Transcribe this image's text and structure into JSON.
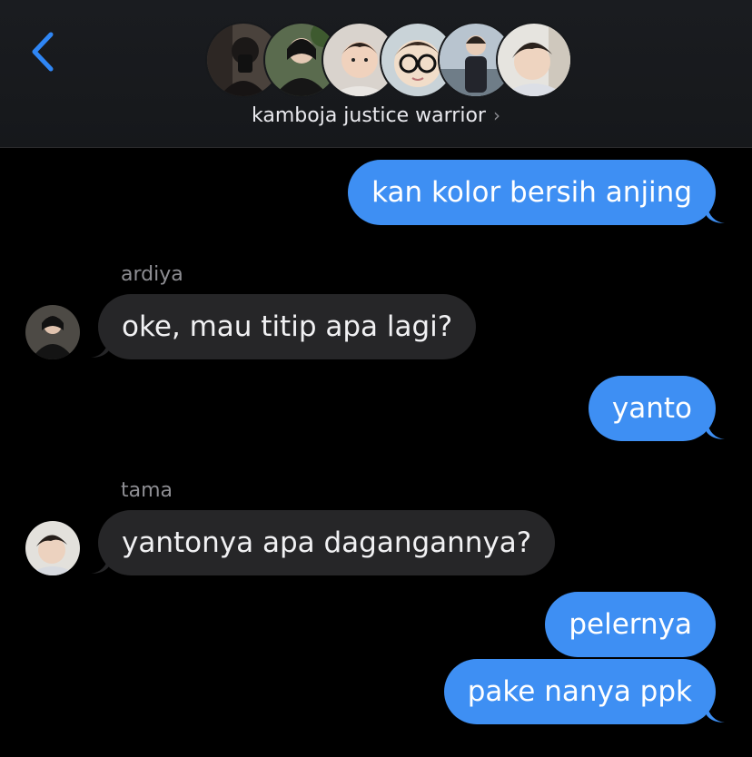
{
  "header": {
    "group_name": "kamboja justice warrior",
    "chevron": "›",
    "back_icon": "chevron-left-icon",
    "accent": "#2f86f5"
  },
  "messages": [
    {
      "side": "sent",
      "text": "kan kolor bersih anjing"
    },
    {
      "side": "recv",
      "sender": "ardiya",
      "text": "oke, mau titip apa lagi?"
    },
    {
      "side": "sent",
      "text": "yanto"
    },
    {
      "side": "recv",
      "sender": "tama",
      "text": "yantonya apa dagangannya?"
    },
    {
      "side": "sent",
      "text": "pelernya"
    },
    {
      "side": "sent",
      "text": "pake nanya ppk"
    }
  ],
  "colors": {
    "sent_bubble": "#3e8ff3",
    "recv_bubble": "#262628",
    "background": "#000000"
  }
}
